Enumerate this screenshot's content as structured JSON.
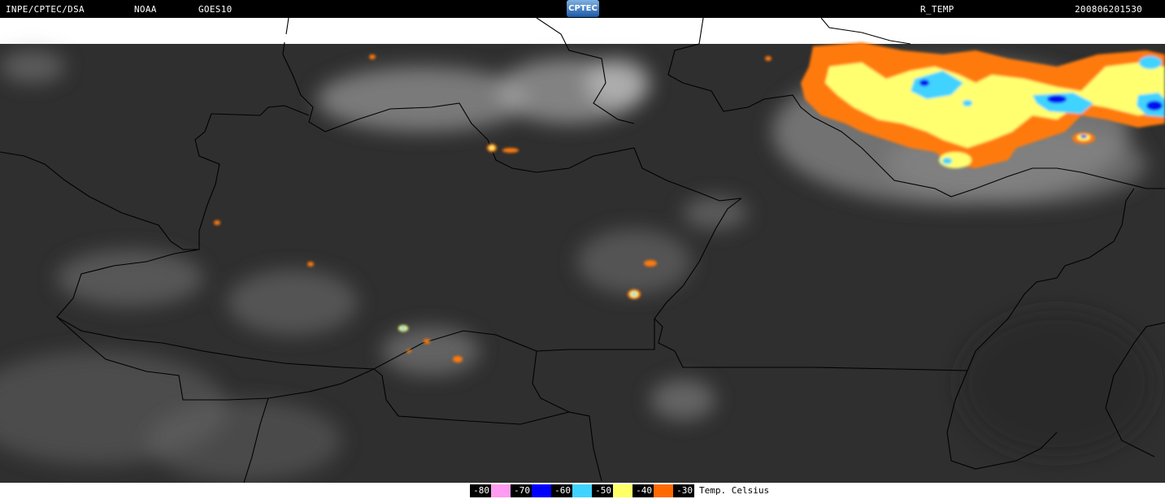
{
  "header": {
    "org": "INPE/CPTEC/DSA",
    "agency": "NOAA",
    "satellite": "GOES10",
    "logo_text": "CPTEC",
    "product": "R_TEMP",
    "timestamp": "200806201530"
  },
  "legend": {
    "entries": [
      {
        "label": "-80",
        "color": "#ff9bf0"
      },
      {
        "label": "-70",
        "color": "#0000ff"
      },
      {
        "label": "-60",
        "color": "#3fd3ff"
      },
      {
        "label": "-50",
        "color": "#ffff66"
      },
      {
        "label": "-40",
        "color": "#ff6a00"
      },
      {
        "label": "-30",
        "color": ""
      }
    ],
    "unit": "Temp. Celsius"
  },
  "colors": {
    "background": "#2b2b2b",
    "cloud": "#b9b9b9",
    "border_line": "#000000",
    "orange": "#ff7a10",
    "yellow": "#ffff70",
    "cyan": "#3fd3ff",
    "blue": "#0010f0"
  }
}
